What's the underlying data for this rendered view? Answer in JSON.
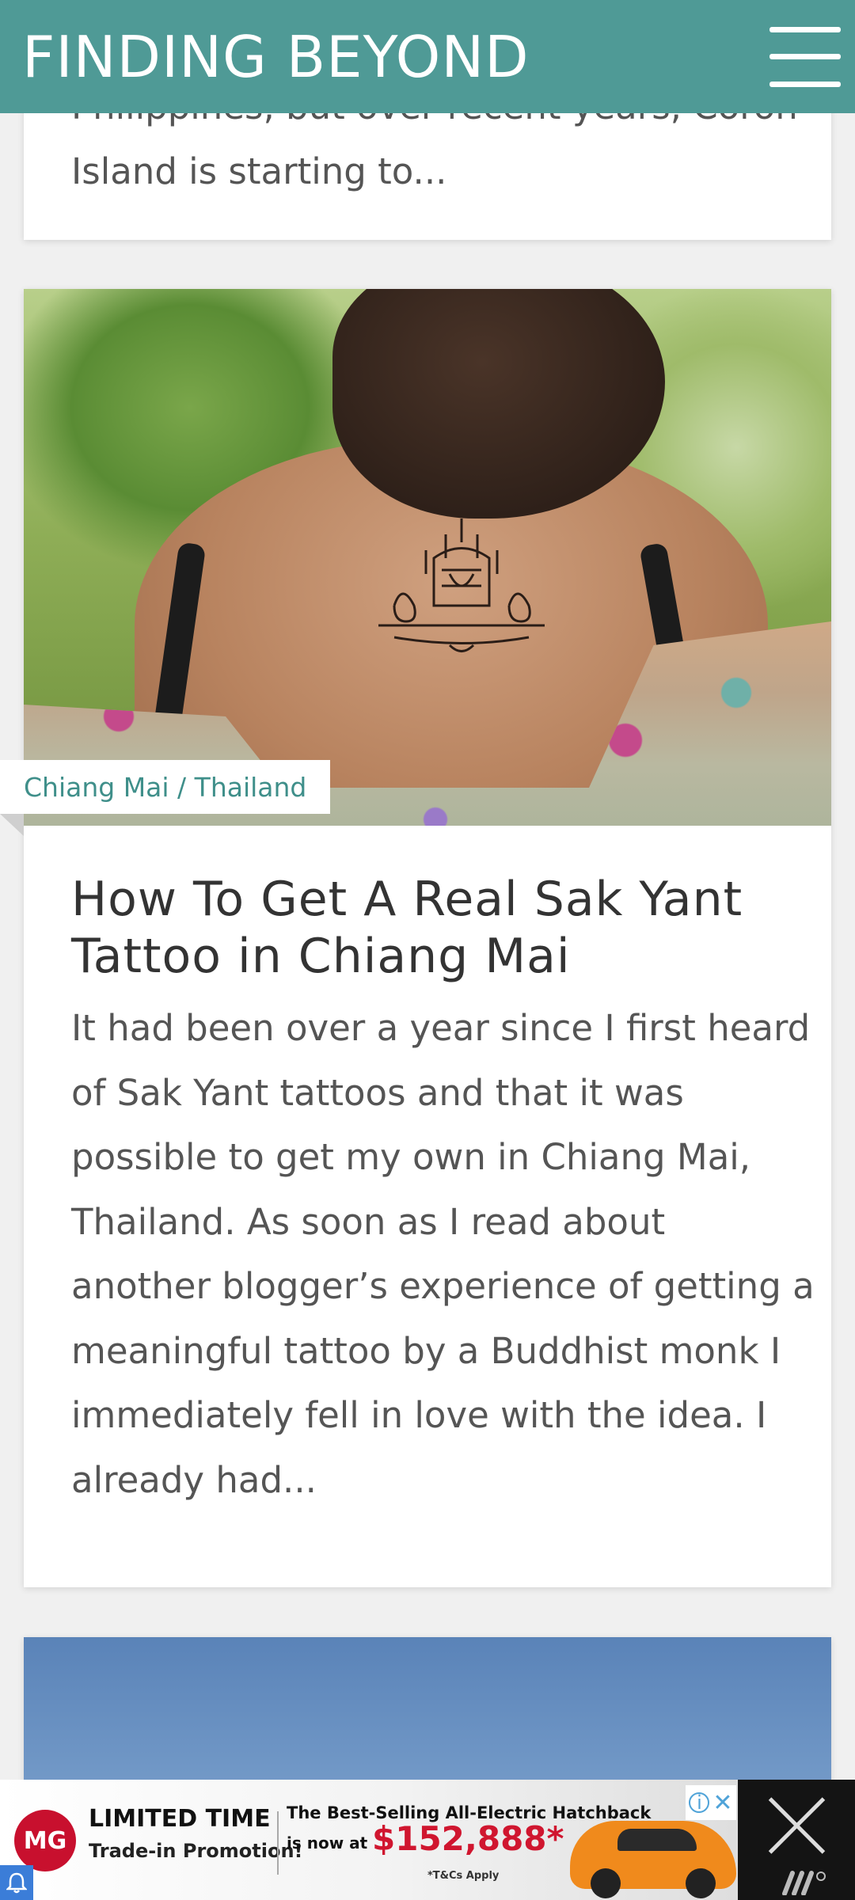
{
  "header": {
    "brand": "FINDING BEYOND"
  },
  "prev_card": {
    "excerpt_visible": "the tourists to this beautiful part of the Philippines, but over recent years, Coron Island is starting to..."
  },
  "article": {
    "category": "Chiang Mai / Thailand",
    "title": "How To Get A Real Sak Yant Tattoo in Chiang Mai",
    "excerpt": "It had been over a year since I first heard of Sak Yant tattoos and that it was possible to get my own in Chiang Mai, Thailand. As soon as I read about another blogger’s experience of getting a meaningful tattoo by a Buddhist monk I immediately fell in love with the idea. I already had..."
  },
  "ad": {
    "logo": "MG",
    "line1": "LIMITED TIME",
    "line2": "Trade-in Promotion!",
    "line3": "The Best-Selling All-Electric Hatchback",
    "line4": "is now at",
    "price": "$152,888*",
    "terms": "*T&Cs Apply",
    "choice_label": "i",
    "colors": {
      "brand": "#c8102e",
      "price": "#d0162f",
      "car": "#f08a1c"
    }
  },
  "colors": {
    "header": "#4f9a96",
    "category": "#3f8f8a"
  }
}
